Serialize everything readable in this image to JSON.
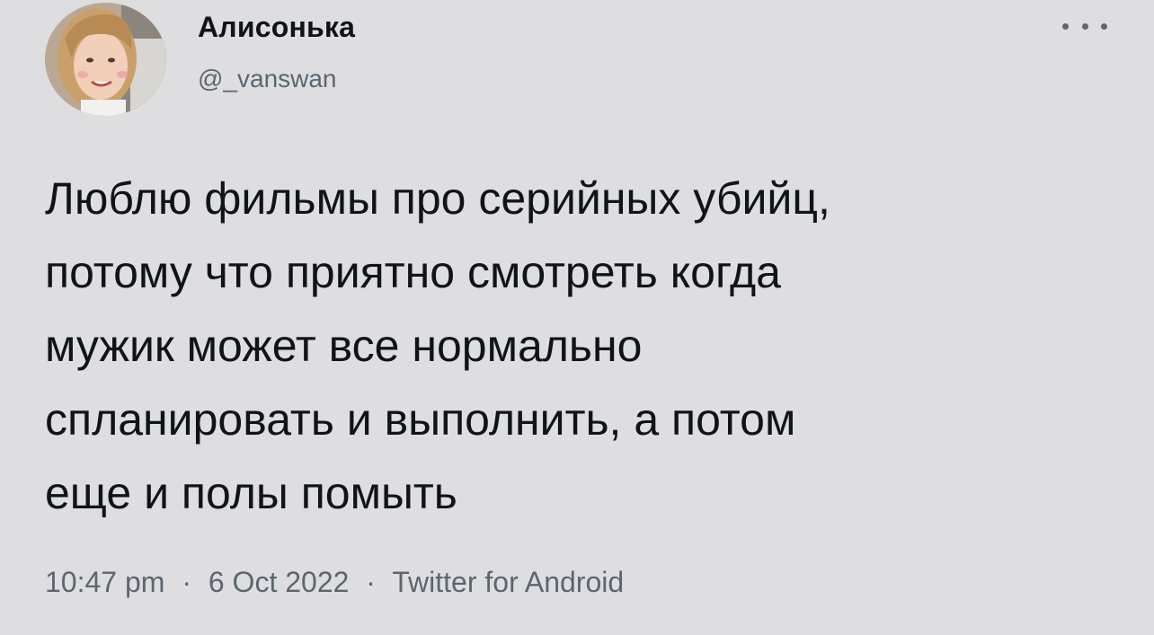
{
  "author": {
    "display_name": "Алисонька",
    "handle": "@_vanswan",
    "avatar_icon": "profile-photo"
  },
  "header": {
    "more_icon": "more-options-icon"
  },
  "tweet": {
    "lines": [
      "Люблю фильмы про серийных убийц,",
      "потому что приятно смотреть когда",
      "мужик может все нормально",
      "спланировать и выполнить, а потом",
      "еще и полы помыть"
    ]
  },
  "meta": {
    "time": "10:47 pm",
    "separator": "·",
    "date": "6 Oct 2022",
    "source": "Twitter for Android"
  },
  "colors": {
    "background": "#dedee0",
    "text": "#0f1419",
    "secondary_text": "#5b6670"
  }
}
